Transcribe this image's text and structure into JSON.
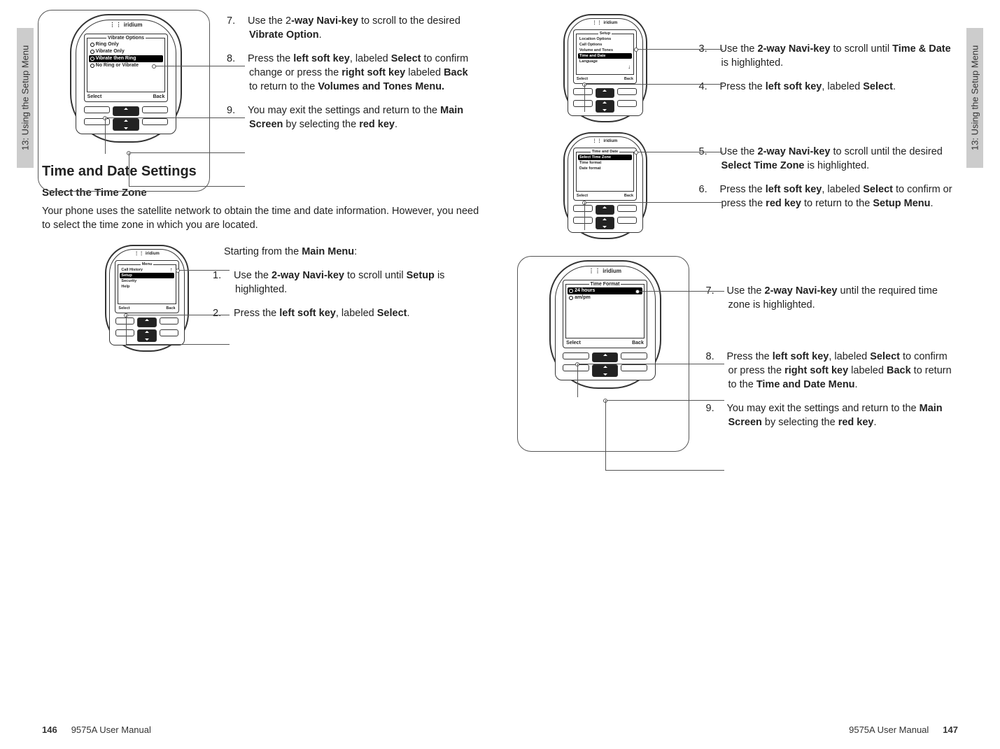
{
  "chapter_tab": "13: Using the Setup Menu",
  "footer": {
    "left_page_num": "146",
    "left_manual": "9575A User Manual",
    "right_manual": "9575A User Manual",
    "right_page_num": "147"
  },
  "brand": "iridium",
  "softkeys": {
    "left": "Select",
    "right": "Back"
  },
  "left_page": {
    "phone1": {
      "title": "Vibrate Options",
      "items": [
        {
          "label": "Ring Only",
          "radio": true,
          "selected": false
        },
        {
          "label": "Vibrate Only",
          "radio": true,
          "selected": false
        },
        {
          "label": "Vibrate then Ring",
          "radio": true,
          "selected": true,
          "filled": true
        },
        {
          "label": "No Ring or Vibrate",
          "radio": true,
          "selected": false
        }
      ]
    },
    "steps_top": {
      "s7a": "7.",
      "s7b": "Use the 2",
      "s7c": "-way Navi-key",
      "s7d": " to scroll to the desired ",
      "s7e": "Vibrate Option",
      "s7f": ".",
      "s8a": "8.",
      "s8b": "Press the ",
      "s8c": "left soft key",
      "s8d": ", labeled ",
      "s8e": "Select",
      "s8f": " to confirm change or press the ",
      "s8g": "right soft key",
      "s8h": " labeled ",
      "s8i": "Back",
      "s8j": " to return to the ",
      "s8k": "Volumes and Tones Menu.",
      "s9a": "9.",
      "s9b": "You may exit the settings and return to the ",
      "s9c": "Main Screen",
      "s9d": " by selecting the ",
      "s9e": "red key",
      "s9f": "."
    },
    "heading": "Time and Date Settings",
    "subheading": "Select the Time Zone",
    "para": "Your phone uses the satellite network to obtain the time and date information. However, you need to select the time zone in which you are located.",
    "phone2": {
      "title": "Menu",
      "items": [
        {
          "label": "Call History",
          "arrow": "↑"
        },
        {
          "label": "Setup",
          "selected": true
        },
        {
          "label": "Security"
        },
        {
          "label": "Help"
        }
      ]
    },
    "steps_bottom": {
      "intro_a": "Starting from the ",
      "intro_b": "Main Menu",
      "intro_c": ":",
      "s1a": "1.",
      "s1b": "Use the ",
      "s1c": "2-way Navi-key",
      "s1d": " to scroll until ",
      "s1e": "Setup",
      "s1f": " is highlighted.",
      "s2a": "2.",
      "s2b": "Press the ",
      "s2c": "left soft key",
      "s2d": ", labeled ",
      "s2e": "Select",
      "s2f": "."
    }
  },
  "right_page": {
    "phone3": {
      "title": "Setup",
      "items": [
        {
          "label": "Location Options"
        },
        {
          "label": "Call Options"
        },
        {
          "label": "Volume and Tones"
        },
        {
          "label": "Time and Date",
          "selected": true
        },
        {
          "label": "Language"
        }
      ],
      "scroll_arrow": "↓"
    },
    "steps_a": {
      "s3a": "3.",
      "s3b": "Use the ",
      "s3c": "2-way Navi-key",
      "s3d": " to scroll until ",
      "s3e": "Time & Date",
      "s3f": " is highlighted.",
      "s4a": "4.",
      "s4b": "Press the ",
      "s4c": "left soft key",
      "s4d": ", labeled ",
      "s4e": "Select",
      "s4f": "."
    },
    "phone4": {
      "title": "Time and Date",
      "items": [
        {
          "label": "Select Time Zone",
          "selected": true
        },
        {
          "label": "Time format"
        },
        {
          "label": "Date format"
        }
      ]
    },
    "steps_b": {
      "s5a": "5.",
      "s5b": "Use the ",
      "s5c": "2-way Navi-key",
      "s5d": " to scroll until the desired ",
      "s5e": "Select Time Zone",
      "s5f": " is highlighted.",
      "s6a": "6.",
      "s6b": "Press the ",
      "s6c": "left soft key",
      "s6d": ", labeled ",
      "s6e": "Select",
      "s6f": " to confirm or press the ",
      "s6g": "red key",
      "s6h": " to return to the ",
      "s6i": "Setup Menu",
      "s6j": "."
    },
    "phone5": {
      "title": "Time Format",
      "items": [
        {
          "label": "24 hours",
          "radio": true,
          "selected": true,
          "filled": true
        },
        {
          "label": "am/pm",
          "radio": true
        }
      ]
    },
    "steps_c": {
      "s7a": "7.",
      "s7b": "Use the ",
      "s7c": "2-way Navi-key",
      "s7d": " until the required time zone is highlighted.",
      "s8a": "8.",
      "s8b": "Press the ",
      "s8c": "left soft key",
      "s8d": ", labeled ",
      "s8e": "Select",
      "s8f": " to confirm or press the ",
      "s8g": "right soft key",
      "s8h": " labeled ",
      "s8i": "Back",
      "s8j": " to return to the ",
      "s8k": "Time and Date Menu",
      "s8l": ".",
      "s9a": "9.",
      "s9b": "You may exit the settings and return to the ",
      "s9c": "Main Screen",
      "s9d": " by selecting the ",
      "s9e": "red key",
      "s9f": "."
    }
  }
}
